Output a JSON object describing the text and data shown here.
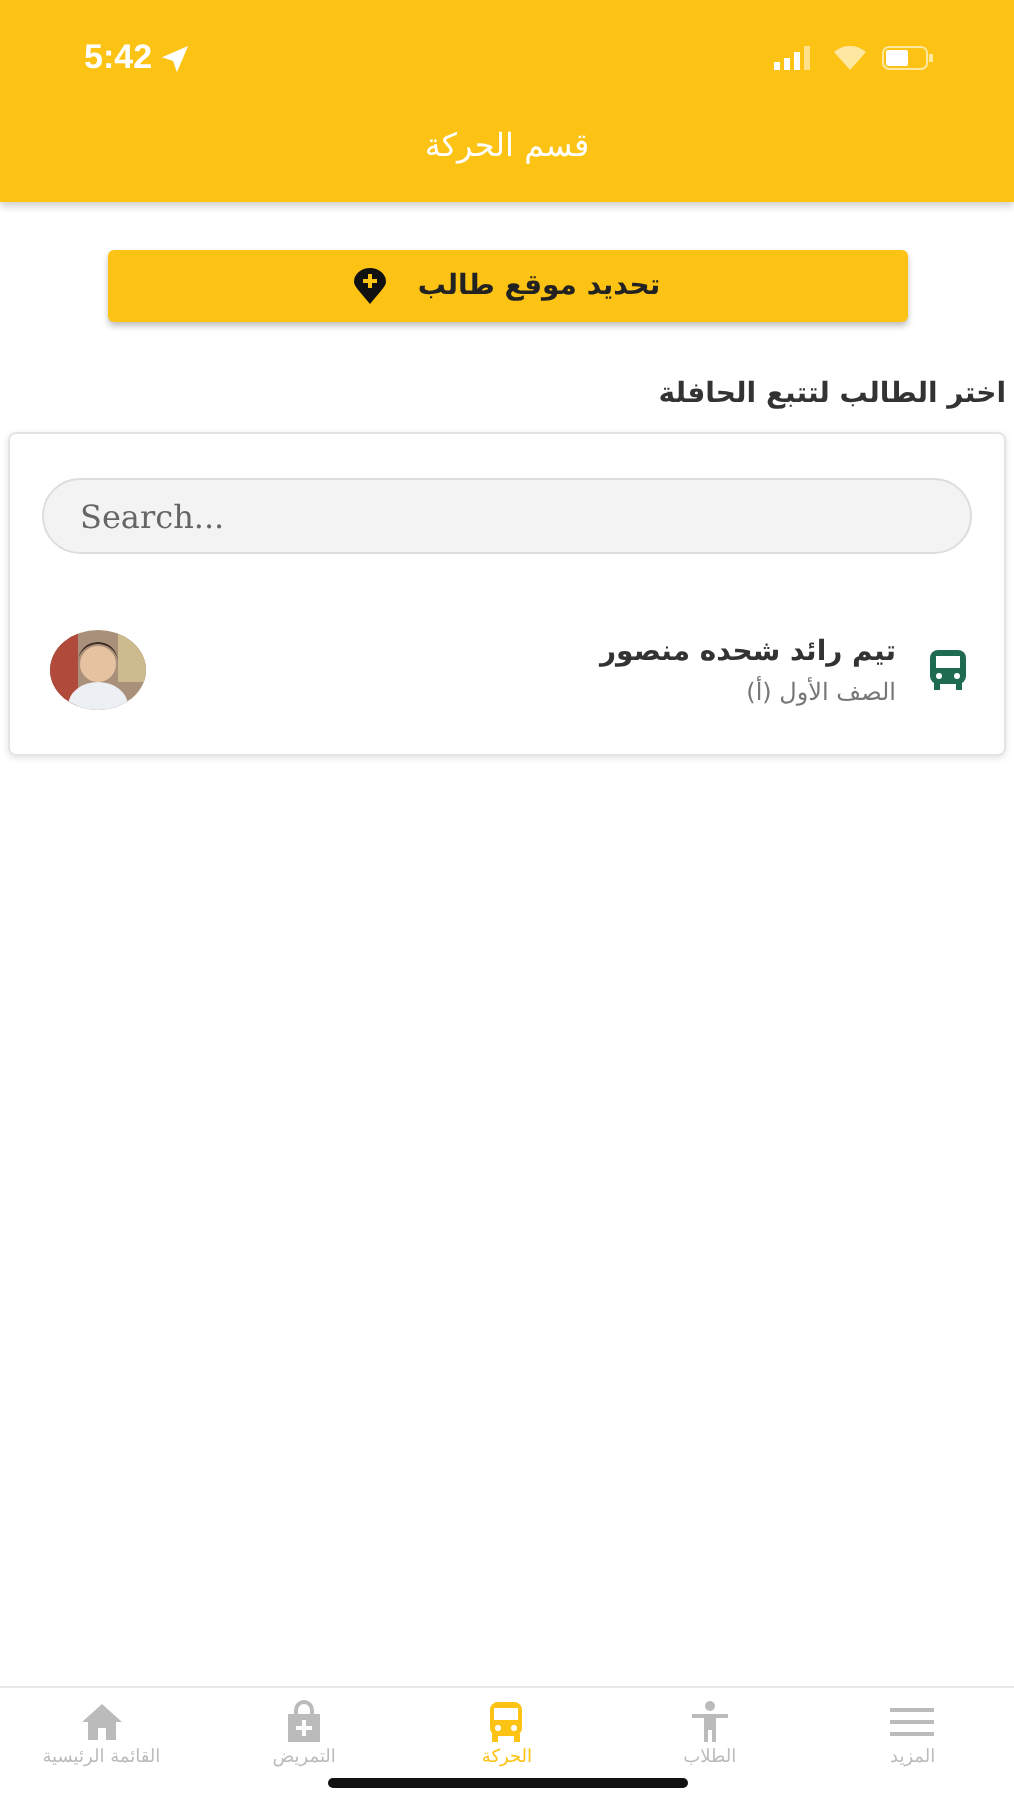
{
  "status_bar": {
    "time": "5:42"
  },
  "header": {
    "title": "قسم الحركة"
  },
  "action_button": {
    "label": "تحديد موقع طالب"
  },
  "section_title": "اختر الطالب لتتبع الحافلة",
  "search": {
    "placeholder": "Search..."
  },
  "students": [
    {
      "name": "تيم رائد شحده منصور",
      "grade": "الصف الأول (أ)"
    }
  ],
  "tab_bar": [
    {
      "label": "المزيد",
      "kind": "menu",
      "selected": false
    },
    {
      "label": "الطلاب",
      "kind": "student",
      "selected": false
    },
    {
      "label": "الحركة",
      "kind": "bus",
      "selected": true
    },
    {
      "label": "التمريض",
      "kind": "nursing",
      "selected": false
    },
    {
      "label": "القائمة الرئيسية",
      "kind": "home",
      "selected": false
    }
  ]
}
